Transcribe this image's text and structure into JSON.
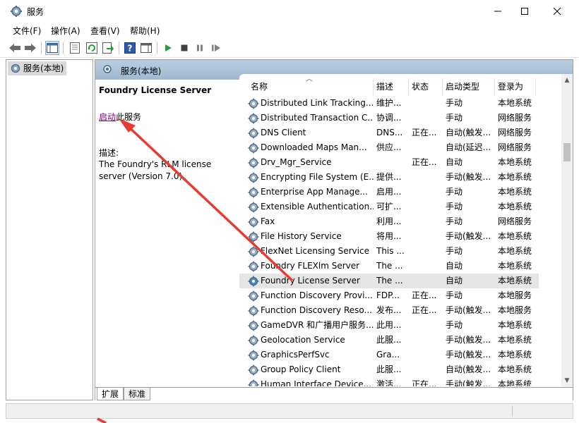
{
  "window": {
    "title": "服务"
  },
  "menu": [
    "文件(F)",
    "操作(A)",
    "查看(V)",
    "帮助(H)"
  ],
  "tree": {
    "root_label": "服务(本地)"
  },
  "main_header": {
    "title": "服务(本地)"
  },
  "detail": {
    "service_name": "Foundry License Server",
    "start_link": "启动",
    "start_suffix": "此服务",
    "desc_label": "描述:",
    "desc_text": "The Foundry's RLM license server (Version 7.0)"
  },
  "columns": {
    "name": "名称",
    "desc": "描述",
    "state": "状态",
    "start_type": "启动类型",
    "logon": "登录为"
  },
  "rows": [
    {
      "name": "Distributed Link Tracking...",
      "desc": "维护...",
      "state": "",
      "type": "手动",
      "logon": "本地系统"
    },
    {
      "name": "Distributed Transaction C...",
      "desc": "协调...",
      "state": "",
      "type": "手动",
      "logon": "网络服务"
    },
    {
      "name": "DNS Client",
      "desc": "DNS...",
      "state": "正在...",
      "type": "自动(触发...",
      "logon": "网络服务"
    },
    {
      "name": "Downloaded Maps Man...",
      "desc": "供应...",
      "state": "",
      "type": "自动(延迟...",
      "logon": "网络服务"
    },
    {
      "name": "Drv_Mgr_Service",
      "desc": "",
      "state": "正在...",
      "type": "自动",
      "logon": "本地系统"
    },
    {
      "name": "Encrypting File System (E...",
      "desc": "提供...",
      "state": "",
      "type": "手动(触发...",
      "logon": "本地系统"
    },
    {
      "name": "Enterprise App Manage...",
      "desc": "启用...",
      "state": "",
      "type": "手动",
      "logon": "本地系统"
    },
    {
      "name": "Extensible Authentication...",
      "desc": "可扩...",
      "state": "",
      "type": "手动",
      "logon": "本地系统"
    },
    {
      "name": "Fax",
      "desc": "利用...",
      "state": "",
      "type": "手动",
      "logon": "网络服务"
    },
    {
      "name": "File History Service",
      "desc": "将用...",
      "state": "",
      "type": "手动(触发...",
      "logon": "本地系统"
    },
    {
      "name": "FlexNet Licensing Service",
      "desc": "This ...",
      "state": "",
      "type": "手动",
      "logon": "本地系统"
    },
    {
      "name": "Foundry FLEXlm Server",
      "desc": "The ...",
      "state": "",
      "type": "自动",
      "logon": "本地系统"
    },
    {
      "name": "Foundry License Server",
      "desc": "The ...",
      "state": "",
      "type": "自动",
      "logon": "本地系统",
      "selected": true
    },
    {
      "name": "Function Discovery Provi...",
      "desc": "FDP...",
      "state": "正在...",
      "type": "手动",
      "logon": "本地服务"
    },
    {
      "name": "Function Discovery Reso...",
      "desc": "发布...",
      "state": "正在...",
      "type": "手动(触发...",
      "logon": "本地服务"
    },
    {
      "name": "GameDVR 和广播用户服务...",
      "desc": "此用...",
      "state": "",
      "type": "手动",
      "logon": "本地系统"
    },
    {
      "name": "Geolocation Service",
      "desc": "此服...",
      "state": "",
      "type": "手动(触发...",
      "logon": "本地系统"
    },
    {
      "name": "GraphicsPerfSvc",
      "desc": "Gra...",
      "state": "",
      "type": "手动(触发...",
      "logon": "本地系统"
    },
    {
      "name": "Group Policy Client",
      "desc": "此服...",
      "state": "",
      "type": "自动(触发...",
      "logon": "本地系统"
    },
    {
      "name": "Human Interface Device...",
      "desc": "激活...",
      "state": "正在...",
      "type": "手动(触发...",
      "logon": "本地系统"
    }
  ],
  "tabs": {
    "extended": "扩展",
    "standard": "标准"
  }
}
